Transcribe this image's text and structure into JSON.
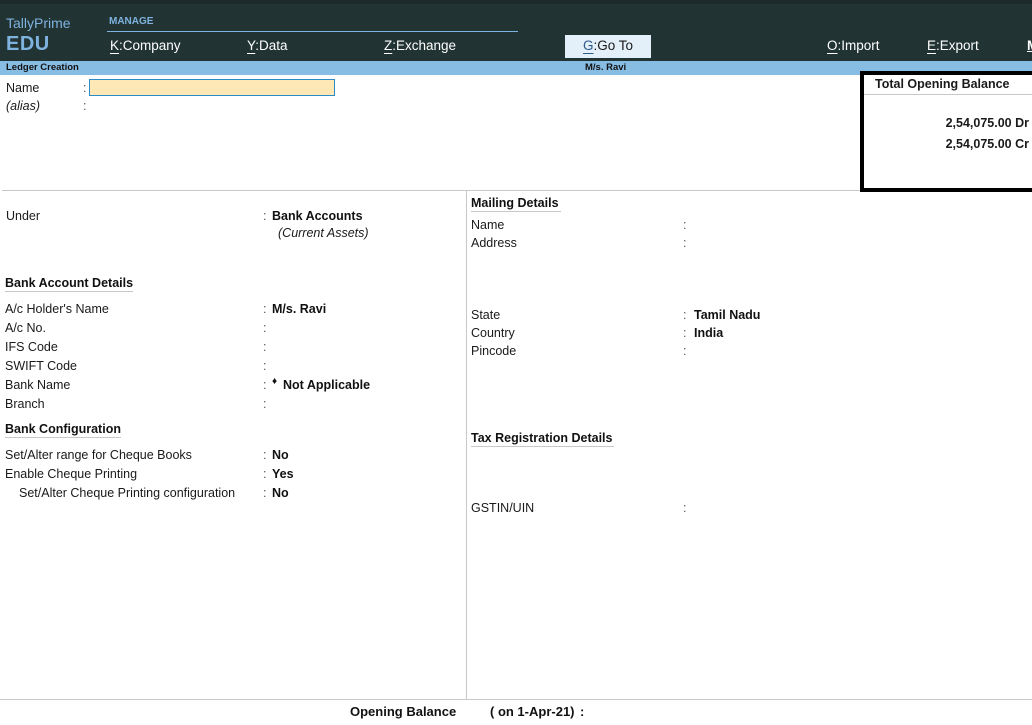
{
  "app": {
    "product": "TallyPrime",
    "edition": "EDU"
  },
  "topmenu": {
    "group_label": "MANAGE",
    "items": [
      {
        "key": "K",
        "label": "Company"
      },
      {
        "key": "Y",
        "label": "Data"
      },
      {
        "key": "Z",
        "label": "Exchange"
      },
      {
        "key": "G",
        "label": "Go To"
      },
      {
        "key": "O",
        "label": "Import"
      },
      {
        "key": "E",
        "label": "Export"
      },
      {
        "key": "M",
        "label": ""
      }
    ]
  },
  "titlebar": {
    "screen": "Ledger Creation",
    "company": "M/s. Ravi"
  },
  "header_fields": {
    "name_label": "Name",
    "name_value": "",
    "alias_label": "(alias)",
    "colon": ":"
  },
  "total_opening_balance": {
    "title": "Total Opening Balance",
    "debit": "2,54,075.00 Dr",
    "credit": "2,54,075.00 Cr"
  },
  "left_panel": {
    "under": {
      "label": "Under",
      "value": "Bank Accounts",
      "sub": "(Current Assets)"
    },
    "bank_account_details": {
      "heading": "Bank Account Details",
      "fields": [
        {
          "label": "A/c Holder's Name",
          "value": "M/s. Ravi"
        },
        {
          "label": "A/c No.",
          "value": ""
        },
        {
          "label": "IFS Code",
          "value": ""
        },
        {
          "label": "SWIFT Code",
          "value": ""
        },
        {
          "label": "Bank Name",
          "value": "Not Applicable",
          "marker": "♦"
        },
        {
          "label": "Branch",
          "value": ""
        }
      ]
    },
    "bank_configuration": {
      "heading": "Bank Configuration",
      "fields": [
        {
          "label": "Set/Alter range for Cheque Books",
          "value": "No"
        },
        {
          "label": "Enable Cheque Printing",
          "value": "Yes"
        },
        {
          "label": "Set/Alter Cheque Printing configuration",
          "value": "No"
        }
      ]
    }
  },
  "right_panel": {
    "mailing_details": {
      "heading": "Mailing Details",
      "fields": [
        {
          "label": "Name",
          "value": ""
        },
        {
          "label": "Address",
          "value": ""
        },
        {
          "label": "State",
          "value": "Tamil Nadu"
        },
        {
          "label": "Country",
          "value": "India"
        },
        {
          "label": "Pincode",
          "value": ""
        }
      ]
    },
    "tax_registration": {
      "heading": "Tax Registration Details",
      "fields": [
        {
          "label": "GSTIN/UIN",
          "value": ""
        }
      ]
    }
  },
  "footer": {
    "label": "Opening Balance",
    "date_text": "( on 1-Apr-21)",
    "colon": ":",
    "value": ""
  }
}
